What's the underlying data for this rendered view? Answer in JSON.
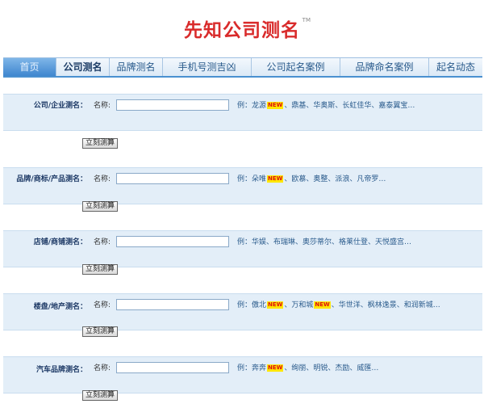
{
  "site": {
    "title": "先知公司测名",
    "tm": "TM"
  },
  "nav": {
    "tabs": [
      {
        "label": "首页",
        "state": "home"
      },
      {
        "label": "公司测名",
        "state": "active"
      },
      {
        "label": "品牌测名",
        "state": ""
      },
      {
        "label": "手机号测吉凶",
        "state": ""
      },
      {
        "label": "公司起名案例",
        "state": ""
      },
      {
        "label": "品牌命名案例",
        "state": ""
      },
      {
        "label": "起名动态",
        "state": ""
      }
    ]
  },
  "form": {
    "name_label": "名称:",
    "submit_label": "立刻测算",
    "sections": [
      {
        "label": "公司/企业测名：",
        "example_prefix": "例：",
        "ex1": "龙源",
        "ex2": "、鼎基、华奥斯、长虹佳华、嘉泰翼宝…",
        "badge1": "NEW",
        "ex3": "",
        "badge2": "",
        "ex4": ""
      },
      {
        "label": "品牌/商标/产品测名：",
        "example_prefix": "例：",
        "ex1": "朵唯",
        "ex2": "、欧慕、奥整、派浪、凡帝罗…",
        "badge1": "NEW",
        "ex3": "",
        "badge2": "",
        "ex4": ""
      },
      {
        "label": "店铺/商铺测名：",
        "example_prefix": "例：",
        "ex1": "华娱、布瑞琳、奥莎蒂尔、格莱仕登、天悦盛宫…",
        "ex2": "",
        "badge1": "",
        "ex3": "",
        "badge2": "",
        "ex4": ""
      },
      {
        "label": "楼盘/地产测名：",
        "example_prefix": "例：",
        "ex1": "傲北",
        "badge1": "NEW",
        "ex2": "、万和城",
        "badge2": "NEW",
        "ex3": "、华世洋、枫林逸景、和润新城…",
        "ex4": ""
      },
      {
        "label": "汽车品牌测名：",
        "example_prefix": "例：",
        "ex1": "奔奔",
        "ex2": "、绚丽、明锐、杰励、威匯…",
        "badge1": "NEW",
        "ex3": "",
        "badge2": "",
        "ex4": ""
      }
    ]
  },
  "colors": {
    "title": "#d92b2b",
    "band": "#e3eef8",
    "link": "#2a5b8c",
    "badge_bg": "#ffe600",
    "badge_fg": "#d11"
  }
}
